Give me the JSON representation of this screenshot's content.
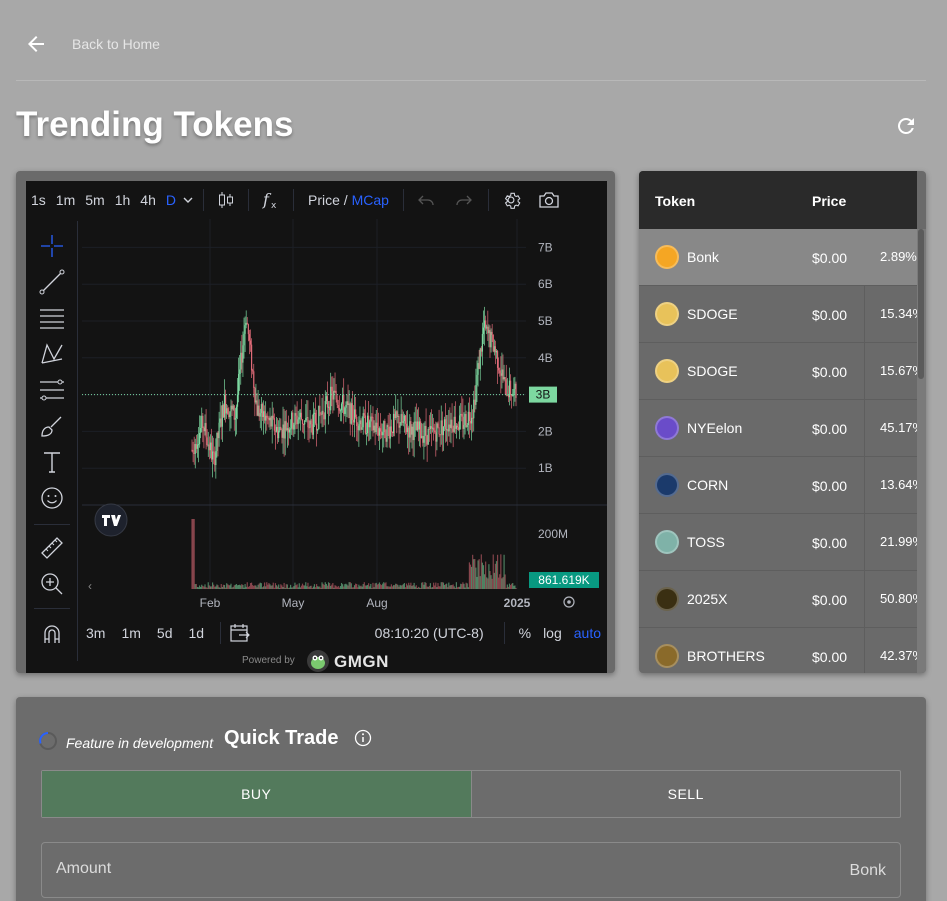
{
  "nav": {
    "back_label": "Back to Home"
  },
  "page": {
    "title": "Trending Tokens"
  },
  "chart": {
    "timeframes": [
      "1s",
      "1m",
      "5m",
      "1h",
      "4h",
      "D"
    ],
    "active_timeframe": "D",
    "price_label": "Price",
    "price_sep": " / ",
    "mcap_label": "MCap",
    "ranges": [
      "3m",
      "1m",
      "5d",
      "1d"
    ],
    "timezone": "08:10:20 (UTC-8)",
    "percent_label": "%",
    "log_label": "log",
    "auto_label": "auto",
    "powered_by": "Powered by",
    "brand": "GMGN",
    "accent_color": "#2962ff",
    "up_color": "#7dd8a0",
    "down_color": "#e06b78"
  },
  "chart_data": {
    "type": "candlestick",
    "x_tick_labels": [
      "Feb",
      "May",
      "Aug",
      "2025"
    ],
    "y_tick_labels": [
      "7B",
      "6B",
      "5B",
      "4B",
      "3B",
      "2B",
      "1B"
    ],
    "current_price_label": "3B",
    "volume_tick_labels": [
      "200M"
    ],
    "current_volume_label": "861.619K",
    "ylim": [
      0,
      7.5
    ],
    "series": [
      {
        "name": "MCap",
        "approx_close": [
          1.5,
          2.2,
          1.2,
          2.8,
          2.4,
          5.2,
          2.6,
          2.3,
          2.0,
          2.2,
          2.4,
          2.1,
          2.5,
          3.0,
          2.7,
          2.4,
          2.2,
          2.1,
          2.0,
          2.3,
          2.1,
          2.0,
          1.9,
          2.1,
          2.3,
          2.2,
          2.6,
          4.8,
          4.3,
          3.2,
          3.0
        ]
      }
    ]
  },
  "tokens": {
    "header_token": "Token",
    "header_price": "Price",
    "items": [
      {
        "name": "Bonk",
        "price": "$0.00",
        "change": "2.89%",
        "icon": "bonk-icon",
        "color": "#f5a623"
      },
      {
        "name": "SDOGE",
        "price": "$0.00",
        "change": "15.34%",
        "icon": "sdoge-icon",
        "color": "#e8c25a"
      },
      {
        "name": "SDOGE",
        "price": "$0.00",
        "change": "15.67%",
        "icon": "sdoge-icon",
        "color": "#e8c25a"
      },
      {
        "name": "NYEelon",
        "price": "$0.00",
        "change": "45.17%",
        "icon": "nyeelon-icon",
        "color": "#6a4cc9"
      },
      {
        "name": "CORN",
        "price": "$0.00",
        "change": "13.64%",
        "icon": "corn-icon",
        "color": "#1b3a6b"
      },
      {
        "name": "TOSS",
        "price": "$0.00",
        "change": "21.99%",
        "icon": "toss-icon",
        "color": "#7fb2a8"
      },
      {
        "name": "2025X",
        "price": "$0.00",
        "change": "50.80%",
        "icon": "2025x-icon",
        "color": "#3a2f12"
      },
      {
        "name": "BROTHERS",
        "price": "$0.00",
        "change": "42.37%",
        "icon": "brothers-icon",
        "color": "#8a6a2a"
      }
    ]
  },
  "trade": {
    "dev_label": "Feature in development",
    "title": "Quick Trade",
    "buy_label": "BUY",
    "sell_label": "SELL",
    "amount_label": "Amount",
    "amount_unit": "Bonk",
    "buy_color": "#537a5c"
  }
}
